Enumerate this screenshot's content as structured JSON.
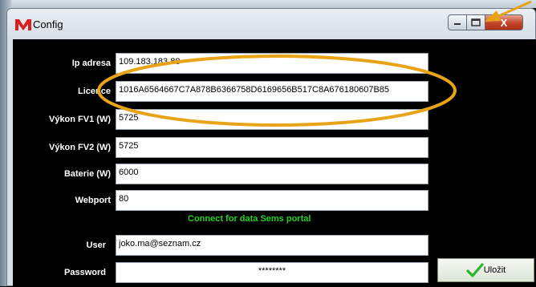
{
  "window": {
    "title": "Config",
    "close_glyph": "X"
  },
  "form": {
    "fields": [
      {
        "label": "Ip adresa",
        "value": "109.183.183.88"
      },
      {
        "label": "Licence",
        "value": "1016A6564667C7A878B6366758D6169656B517C8A676180607B85"
      },
      {
        "label": "Výkon FV1 (W)",
        "value": "5725"
      },
      {
        "label": "Výkon FV2 (W)",
        "value": "5725"
      },
      {
        "label": "Baterie (W)",
        "value": "6000"
      },
      {
        "label": "Webport",
        "value": "80"
      }
    ],
    "section_heading": "Connect for data Sems portal",
    "user": {
      "label": "User",
      "value": "joko.ma@seznam.cz"
    },
    "password": {
      "label": "Password",
      "value": "********"
    }
  },
  "actions": {
    "save_label": "Uložit"
  },
  "colors": {
    "heading_green": "#1ed41e",
    "annotation_orange": "#e8a317",
    "close_red": "#c2432a"
  },
  "icons": {
    "app": "app-logo-icon",
    "save": "checkmark-icon"
  }
}
